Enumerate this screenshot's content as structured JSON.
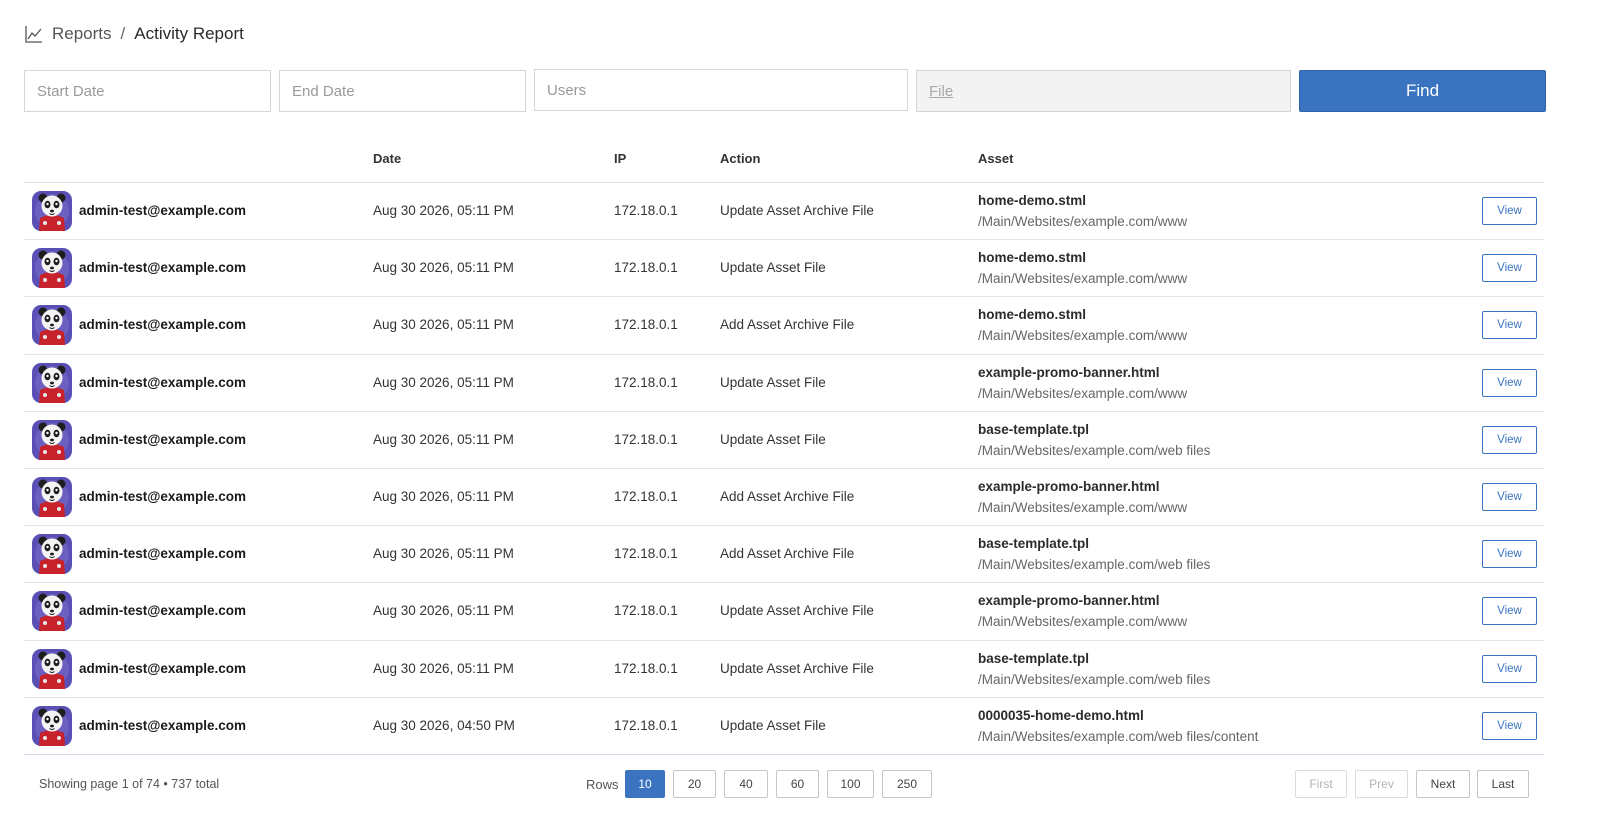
{
  "breadcrumb": {
    "icon": "line-chart-icon",
    "parent": "Reports",
    "separator": "/",
    "current": "Activity Report"
  },
  "filters": {
    "start_date_placeholder": "Start Date",
    "end_date_placeholder": "End Date",
    "users_placeholder": "Users",
    "file_placeholder": "File",
    "find_label": "Find"
  },
  "table": {
    "headers": {
      "user": "",
      "date": "Date",
      "ip": "IP",
      "action": "Action",
      "asset": "Asset"
    },
    "view_label": "View",
    "rows": [
      {
        "user": "admin-test@example.com",
        "date": "Aug 30 2026, 05:11 PM",
        "ip": "172.18.0.1",
        "action": "Update Asset Archive File",
        "asset_name": "home-demo.stml",
        "asset_path": "/Main/Websites/example.com/www"
      },
      {
        "user": "admin-test@example.com",
        "date": "Aug 30 2026, 05:11 PM",
        "ip": "172.18.0.1",
        "action": "Update Asset File",
        "asset_name": "home-demo.stml",
        "asset_path": "/Main/Websites/example.com/www"
      },
      {
        "user": "admin-test@example.com",
        "date": "Aug 30 2026, 05:11 PM",
        "ip": "172.18.0.1",
        "action": "Add Asset Archive File",
        "asset_name": "home-demo.stml",
        "asset_path": "/Main/Websites/example.com/www"
      },
      {
        "user": "admin-test@example.com",
        "date": "Aug 30 2026, 05:11 PM",
        "ip": "172.18.0.1",
        "action": "Update Asset File",
        "asset_name": "example-promo-banner.html",
        "asset_path": "/Main/Websites/example.com/www"
      },
      {
        "user": "admin-test@example.com",
        "date": "Aug 30 2026, 05:11 PM",
        "ip": "172.18.0.1",
        "action": "Update Asset File",
        "asset_name": "base-template.tpl",
        "asset_path": "/Main/Websites/example.com/web files"
      },
      {
        "user": "admin-test@example.com",
        "date": "Aug 30 2026, 05:11 PM",
        "ip": "172.18.0.1",
        "action": "Add Asset Archive File",
        "asset_name": "example-promo-banner.html",
        "asset_path": "/Main/Websites/example.com/www"
      },
      {
        "user": "admin-test@example.com",
        "date": "Aug 30 2026, 05:11 PM",
        "ip": "172.18.0.1",
        "action": "Add Asset Archive File",
        "asset_name": "base-template.tpl",
        "asset_path": "/Main/Websites/example.com/web files"
      },
      {
        "user": "admin-test@example.com",
        "date": "Aug 30 2026, 05:11 PM",
        "ip": "172.18.0.1",
        "action": "Update Asset Archive File",
        "asset_name": "example-promo-banner.html",
        "asset_path": "/Main/Websites/example.com/www"
      },
      {
        "user": "admin-test@example.com",
        "date": "Aug 30 2026, 05:11 PM",
        "ip": "172.18.0.1",
        "action": "Update Asset Archive File",
        "asset_name": "base-template.tpl",
        "asset_path": "/Main/Websites/example.com/web files"
      },
      {
        "user": "admin-test@example.com",
        "date": "Aug 30 2026, 04:50 PM",
        "ip": "172.18.0.1",
        "action": "Update Asset File",
        "asset_name": "0000035-home-demo.html",
        "asset_path": "/Main/Websites/example.com/web files/content"
      }
    ]
  },
  "footer": {
    "showing_text": "Showing page 1 of 74 • 737 total",
    "rows_label": "Rows",
    "rows_options": [
      "10",
      "20",
      "40",
      "60",
      "100",
      "250"
    ],
    "rows_selected": "10",
    "first_label": "First",
    "prev_label": "Prev",
    "next_label": "Next",
    "last_label": "Last"
  },
  "colors": {
    "accent": "#3a74c1",
    "avatar_bg": "#5a4fb5",
    "avatar_suit": "#c8232c"
  },
  "icons": {
    "avatar": "panda-avatar-icon",
    "breadcrumb": "line-chart-icon"
  }
}
